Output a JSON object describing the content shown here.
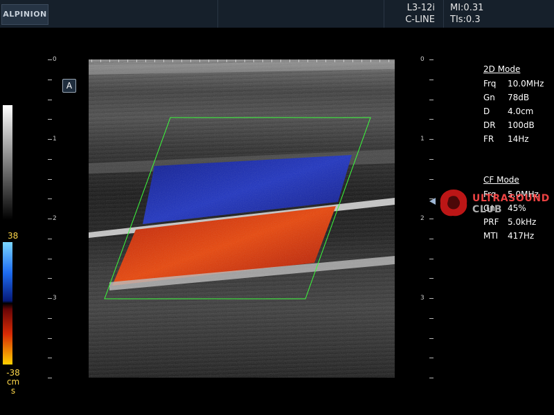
{
  "brand": "ALPINION",
  "header": {
    "probe": "L3-12i",
    "mode": "C-LINE",
    "mi": "MI:0.31",
    "tis": "TIs:0.3"
  },
  "orientation_marker": "A",
  "depth_scale": {
    "labels": [
      "0",
      "1",
      "2",
      "3"
    ]
  },
  "color_scale": {
    "top_value": "38",
    "bottom_value": "-38",
    "unit": "cm\ns"
  },
  "mode_2d": {
    "title": "2D Mode",
    "params": [
      {
        "k": "Frq",
        "v": "10.0MHz"
      },
      {
        "k": "Gn",
        "v": "78dB"
      },
      {
        "k": "D",
        "v": "4.0cm"
      },
      {
        "k": "DR",
        "v": "100dB"
      },
      {
        "k": "FR",
        "v": "14Hz"
      }
    ]
  },
  "mode_cf": {
    "title": "CF Mode",
    "params": [
      {
        "k": "Frq",
        "v": "5.0MHz"
      },
      {
        "k": "Gn",
        "v": "45%"
      },
      {
        "k": "PRF",
        "v": "5.0kHz"
      },
      {
        "k": "MTI",
        "v": "417Hz"
      }
    ]
  },
  "watermark": {
    "line1": "ULTRASOUND",
    "line2": "CLUB"
  },
  "colors": {
    "flow_toward": "#e03a08",
    "flow_away": "#1a2bb0",
    "roi_box": "#3cff3c",
    "scale_text": "#ffd84a"
  }
}
